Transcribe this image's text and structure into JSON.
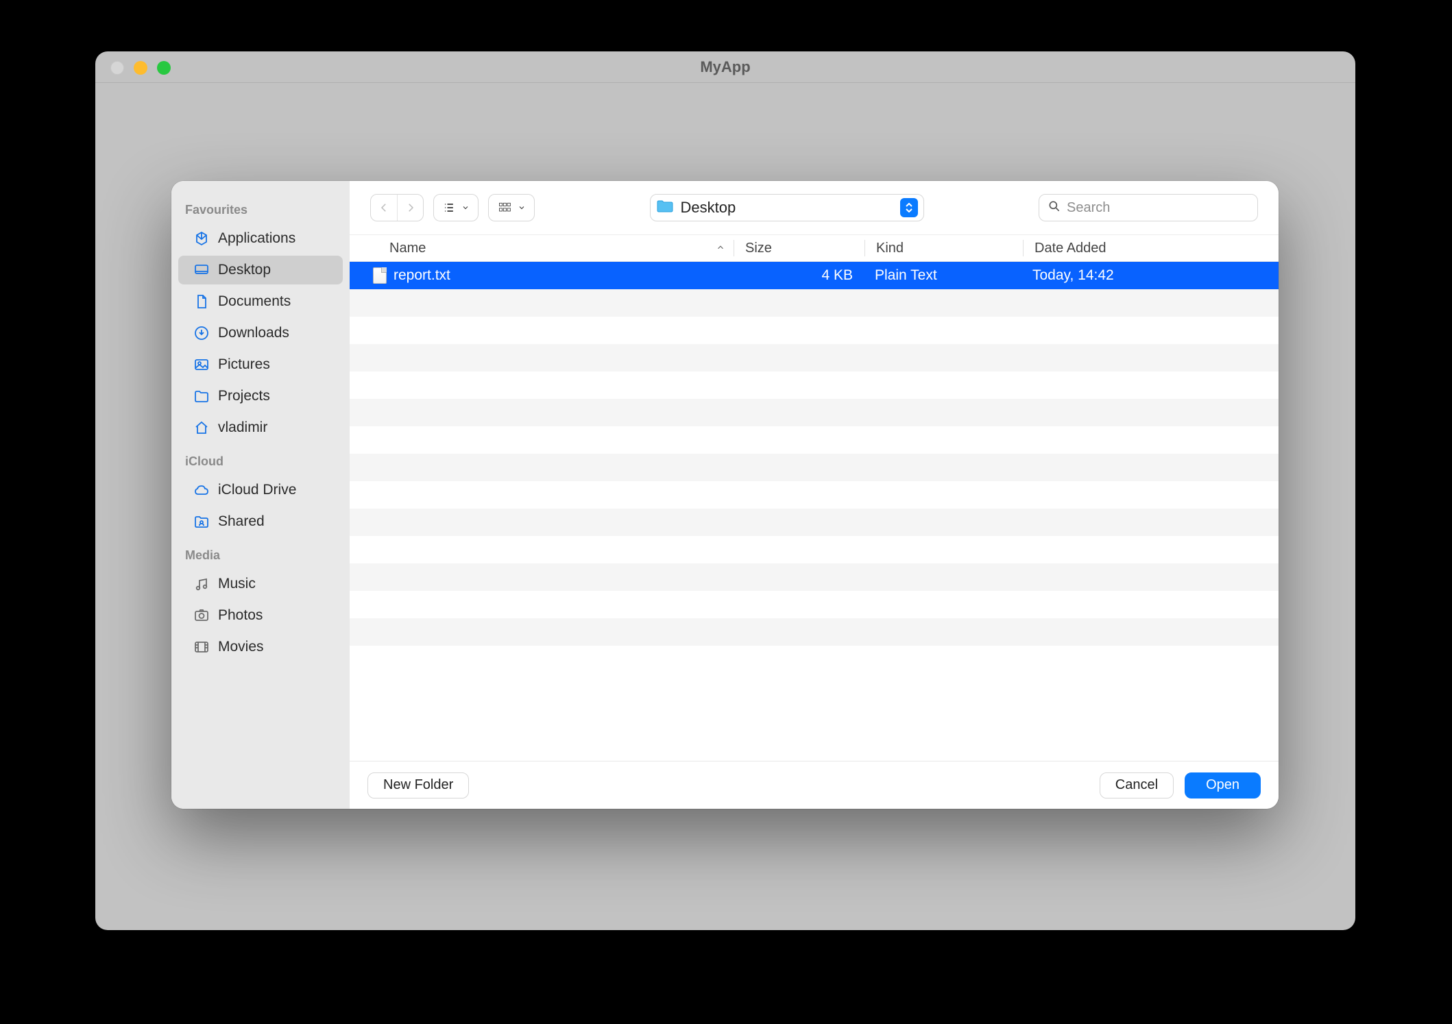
{
  "window": {
    "title": "MyApp"
  },
  "sidebar": {
    "sections": [
      {
        "title": "Favourites",
        "items": [
          {
            "icon": "app-store-icon",
            "label": "Applications",
            "active": false
          },
          {
            "icon": "desktop-icon",
            "label": "Desktop",
            "active": true
          },
          {
            "icon": "document-icon",
            "label": "Documents",
            "active": false
          },
          {
            "icon": "download-icon",
            "label": "Downloads",
            "active": false
          },
          {
            "icon": "pictures-icon",
            "label": "Pictures",
            "active": false
          },
          {
            "icon": "folder-icon",
            "label": "Projects",
            "active": false
          },
          {
            "icon": "home-icon",
            "label": "vladimir",
            "active": false
          }
        ]
      },
      {
        "title": "iCloud",
        "items": [
          {
            "icon": "cloud-icon",
            "label": "iCloud Drive",
            "active": false
          },
          {
            "icon": "shared-folder-icon",
            "label": "Shared",
            "active": false
          }
        ]
      },
      {
        "title": "Media",
        "items": [
          {
            "icon": "music-icon",
            "label": "Music",
            "active": false
          },
          {
            "icon": "photos-icon",
            "label": "Photos",
            "active": false
          },
          {
            "icon": "movies-icon",
            "label": "Movies",
            "active": false
          }
        ]
      }
    ]
  },
  "toolbar": {
    "location": "Desktop",
    "search_placeholder": "Search"
  },
  "columns": {
    "name": "Name",
    "size": "Size",
    "kind": "Kind",
    "date": "Date Added",
    "sort_column": "name",
    "sort_ascending": true
  },
  "files": [
    {
      "name": "report.txt",
      "size": "4 KB",
      "kind": "Plain Text",
      "date_added": "Today, 14:42",
      "selected": true
    }
  ],
  "footer": {
    "new_folder": "New Folder",
    "cancel": "Cancel",
    "open": "Open"
  },
  "empty_row_count": 13
}
